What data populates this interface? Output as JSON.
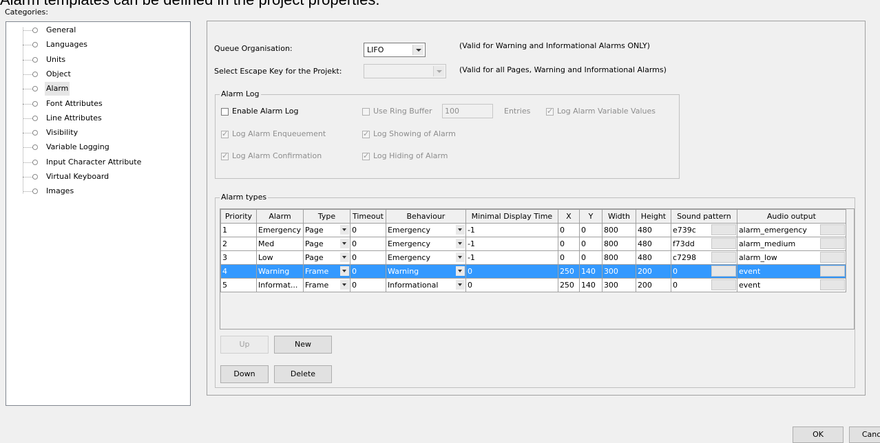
{
  "banner": "Alarm templates can be defined in the project properties.",
  "categories_label": "Categories:",
  "categories": [
    "General",
    "Languages",
    "Units",
    "Object",
    "Alarm",
    "Font Attributes",
    "Line Attributes",
    "Visibility",
    "Variable Logging",
    "Input Character Attribute",
    "Virtual Keyboard",
    "Images"
  ],
  "selected_category": "Alarm",
  "queue": {
    "label": "Queue Organisation:",
    "value": "LIFO",
    "note": "(Valid for Warning and Informational Alarms ONLY)"
  },
  "escape": {
    "label": "Select Escape Key for the Projekt:",
    "value": "",
    "note": "(Valid for all Pages, Warning and Informational Alarms)"
  },
  "alarm_log": {
    "title": "Alarm Log",
    "enable": "Enable Alarm Log",
    "ring_buffer": "Use Ring Buffer",
    "ring_value": "100",
    "entries": "Entries",
    "log_values": "Log Alarm Variable Values",
    "enqueue": "Log Alarm Enqueuement",
    "showing": "Log Showing of Alarm",
    "confirmation": "Log Alarm Confirmation",
    "hiding": "Log Hiding of Alarm"
  },
  "alarm_types": {
    "title": "Alarm types",
    "columns": [
      "Priority",
      "Alarm",
      "Type",
      "Timeout",
      "Behaviour",
      "Minimal Display Time",
      "X",
      "Y",
      "Width",
      "Height",
      "Sound pattern",
      "Audio output"
    ],
    "rows": [
      [
        "1",
        "Emergency",
        "Page",
        "0",
        "Emergency",
        "-1",
        "0",
        "0",
        "800",
        "480",
        "e739c",
        "alarm_emergency"
      ],
      [
        "2",
        "Med",
        "Page",
        "0",
        "Emergency",
        "-1",
        "0",
        "0",
        "800",
        "480",
        "f73dd",
        "alarm_medium"
      ],
      [
        "3",
        "Low",
        "Page",
        "0",
        "Emergency",
        "-1",
        "0",
        "0",
        "800",
        "480",
        "c7298",
        "alarm_low"
      ],
      [
        "4",
        "Warning",
        "Frame",
        "0",
        "Warning",
        "0",
        "250",
        "140",
        "300",
        "200",
        "0",
        "event"
      ],
      [
        "5",
        "Informat...",
        "Frame",
        "0",
        "Informational",
        "0",
        "250",
        "140",
        "300",
        "200",
        "0",
        "event"
      ]
    ],
    "selected_row": 3
  },
  "buttons": {
    "up": "Up",
    "new": "New",
    "down": "Down",
    "delete": "Delete",
    "ok": "OK",
    "cancel": "Cancel"
  }
}
